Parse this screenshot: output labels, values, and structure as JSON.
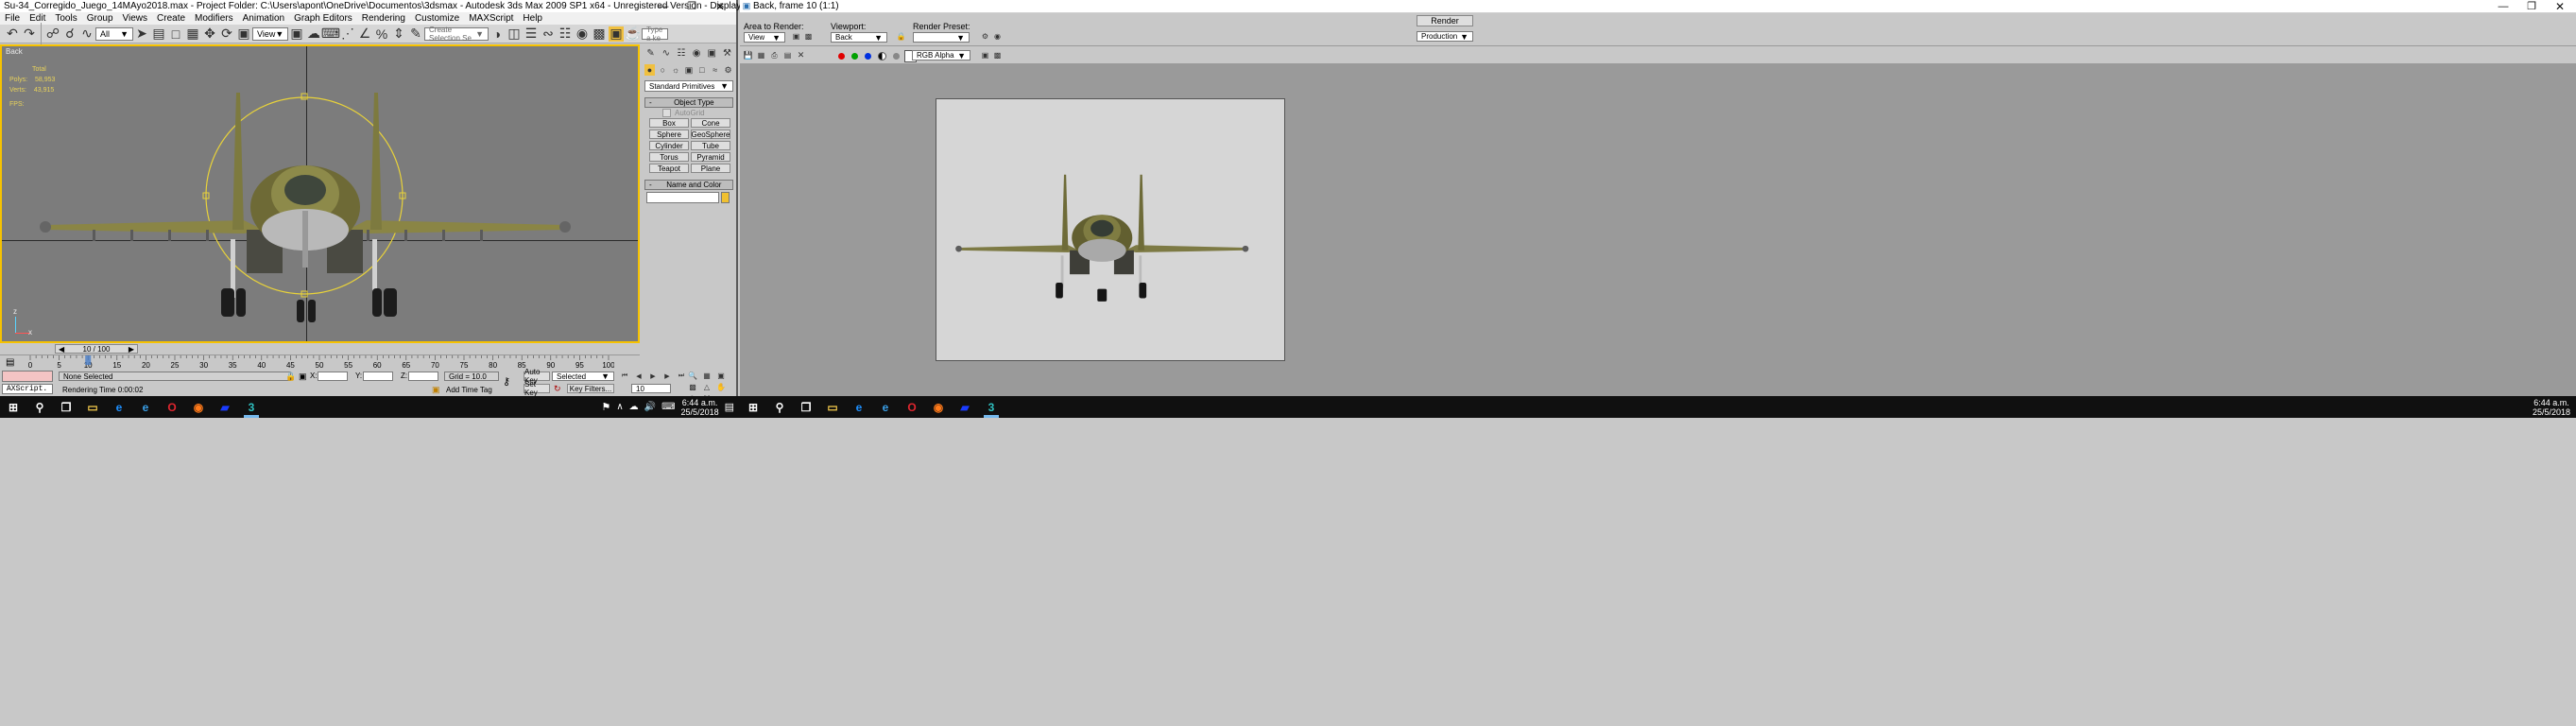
{
  "max": {
    "title": "Su-34_Corregido_Juego_14MAyo2018.max    - Project Folder: C:\\Users\\apont\\OneDrive\\Documentos\\3dsmax    - Autodesk 3ds Max  2009 SP1  x64    - Unregistered Version     - Display : Direct 3D",
    "menu": [
      "File",
      "Edit",
      "Tools",
      "Group",
      "Views",
      "Create",
      "Modifiers",
      "Animation",
      "Graph Editors",
      "Rendering",
      "Customize",
      "MAXScript",
      "Help"
    ],
    "toolbar": {
      "filter": "All",
      "ref_coord": "View",
      "selection_set": "Create Selection Se",
      "search_placeholder": "Type a ke"
    },
    "viewport": {
      "label": "Back",
      "stats_header": "Total",
      "polys_label": "Polys:",
      "polys_value": "58,953",
      "verts_label": "Verts:",
      "verts_value": "43,915",
      "fps_label": "FPS:",
      "axis_z": "z",
      "axis_x": "x"
    },
    "command_panel": {
      "category": "Standard Primitives",
      "object_type_title": "Object Type",
      "autogrid": "AutoGrid",
      "buttons": [
        "Box",
        "Cone",
        "Sphere",
        "GeoSphere",
        "Cylinder",
        "Tube",
        "Torus",
        "Pyramid",
        "Teapot",
        "Plane"
      ],
      "name_color_title": "Name and Color",
      "object_color": "#f0c030"
    },
    "time": {
      "slider": "10 / 100",
      "current_frame": 10,
      "total_frames": 100,
      "ticks": [
        "0",
        "5",
        "10",
        "15",
        "20",
        "25",
        "30",
        "35",
        "40",
        "45",
        "50",
        "55",
        "60",
        "65",
        "70",
        "75",
        "80",
        "85",
        "90",
        "95",
        "100"
      ]
    },
    "status": {
      "maxscript": "AXScript.",
      "selection": "None Selected",
      "prompt": "Rendering Time  0:00:02",
      "x_label": "X:",
      "y_label": "Y:",
      "z_label": "Z:",
      "grid": "Grid = 10.0",
      "add_time_tag": "Add Time Tag",
      "auto_key": "Auto Key",
      "set_key": "Set Key",
      "key_mode": "Selected",
      "key_filters": "Key Filters...",
      "frame_field": "10"
    }
  },
  "render": {
    "title": "Back, frame 10 (1:1)",
    "area_label": "Area to Render:",
    "area_value": "View",
    "viewport_label": "Viewport:",
    "viewport_value": "Back",
    "preset_label": "Render Preset:",
    "preset_value": "",
    "render_button": "Render",
    "production": "Production",
    "channel": "RGB Alpha"
  },
  "taskbar_left": {
    "time": "6:44 a.m.",
    "date": "25/5/2018",
    "apps": [
      "start",
      "search",
      "task-view",
      "file-explorer",
      "edge",
      "ie",
      "opera",
      "firefox",
      "amd",
      "3dsmax"
    ]
  },
  "taskbar_right": {
    "time": "6:44 a.m.",
    "date": "25/5/2018",
    "apps": [
      "start",
      "search",
      "task-view",
      "file-explorer",
      "edge",
      "ie",
      "opera",
      "firefox",
      "amd",
      "3dsmax"
    ]
  }
}
